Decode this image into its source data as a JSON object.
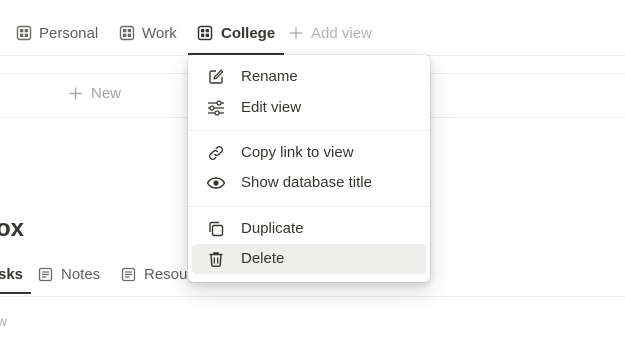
{
  "view_tabs": [
    {
      "label": "Personal",
      "icon": "table-icon"
    },
    {
      "label": "Work",
      "icon": "table-icon"
    },
    {
      "label": "College",
      "icon": "table-icon",
      "active": true
    }
  ],
  "add_view": {
    "label": "Add view",
    "icon": "plus-icon"
  },
  "board": {
    "new_label": "New"
  },
  "heading_partial": "ox",
  "lower_tabs": [
    {
      "label": "sks",
      "active": true
    },
    {
      "label": "Notes",
      "icon": "document-icon"
    },
    {
      "label": "Resou",
      "icon": "document-icon"
    }
  ],
  "partial_text": "w",
  "context_menu": {
    "items": [
      {
        "label": "Rename",
        "icon": "pencil-square-icon"
      },
      {
        "label": "Edit view",
        "icon": "sliders-icon"
      },
      {
        "label": "Copy link to view",
        "icon": "link-icon"
      },
      {
        "label": "Show database title",
        "icon": "eye-icon"
      },
      {
        "label": "Duplicate",
        "icon": "duplicate-icon"
      },
      {
        "label": "Delete",
        "icon": "trash-icon",
        "hovered": true
      }
    ]
  },
  "colors": {
    "text": "#37352f",
    "muted": "#5f5e5b",
    "hover_bg": "#efefee",
    "divider": "#ededec"
  }
}
